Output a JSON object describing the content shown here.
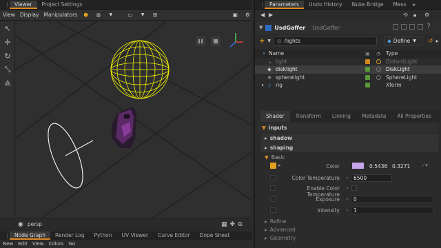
{
  "left_tabs": [
    "Viewer",
    "Project Settings"
  ],
  "viewer_menu": [
    "View",
    "Display",
    "Manipulators"
  ],
  "viewport": {
    "camera": "persp"
  },
  "bottom_tabs": [
    "Node Graph",
    "Render Log",
    "Python",
    "UV Viewer",
    "Curve Editor",
    "Dope Sheet"
  ],
  "bottom_menu": [
    "New",
    "Edit",
    "View",
    "Colors",
    "Go"
  ],
  "right_tabs": [
    "Parameters",
    "Undo History",
    "Nuke Bridge",
    "Mess"
  ],
  "node": {
    "name": "UsdGaffer",
    "type": "UsdGaffer"
  },
  "path": {
    "value": "/lights",
    "mode": "Define"
  },
  "tree": {
    "headers": {
      "name": "Name",
      "type": "Type"
    },
    "rows": [
      {
        "name": "light",
        "type": "DistantLight",
        "dim": true
      },
      {
        "name": "disklight",
        "type": "DiskLight",
        "selected": true
      },
      {
        "name": "spherelight",
        "type": "SphereLight"
      },
      {
        "name": "rig",
        "type": "Xform"
      }
    ]
  },
  "param_tabs": [
    "Shader",
    "Transform",
    "Linking",
    "Metadata",
    "All Properties"
  ],
  "sections": {
    "inputs": "inputs",
    "shadow": "shadow",
    "shaping": "shaping",
    "basic": "Basic",
    "refine": "Refine",
    "advanced": "Advanced",
    "geometry": "Geometry"
  },
  "params": {
    "color": {
      "label": "Color",
      "r": "0.5436",
      "g": "0.3271",
      "swatch": "#c7a4e8"
    },
    "color_temperature": {
      "label": "Color Temperature",
      "value": "6500"
    },
    "enable_color_temperature": {
      "label": "Enable Color Temperature"
    },
    "exposure": {
      "label": "Exposure",
      "value": "0"
    },
    "intensity": {
      "label": "Intensity",
      "value": "1"
    }
  },
  "colors": {
    "accent": "#e08a1e",
    "sphere_wire": "#f2f200",
    "selection": "#3e3e3e"
  }
}
